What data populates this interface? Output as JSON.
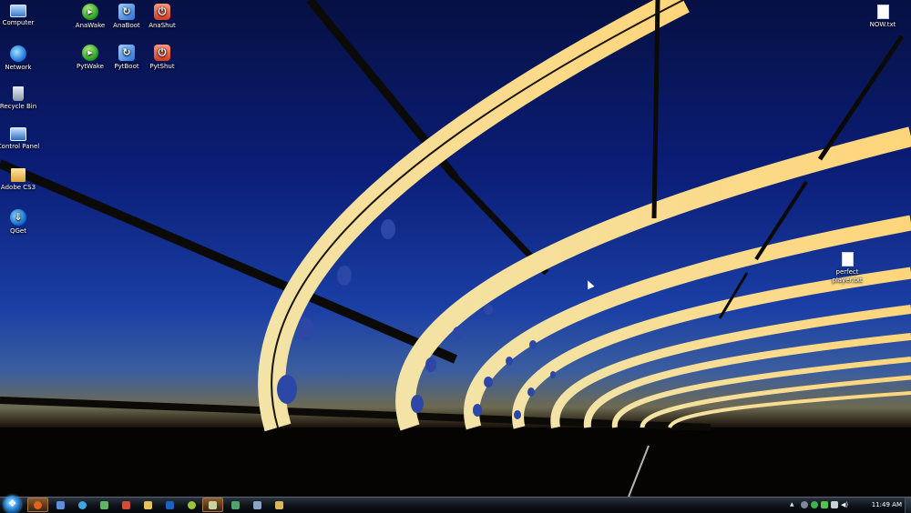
{
  "desktop": {
    "left_icons": [
      {
        "label": "Computer",
        "icon": "computer-icon"
      },
      {
        "label": "Network",
        "icon": "network-icon"
      },
      {
        "label": "Recycle Bin",
        "icon": "recycle-bin-icon"
      },
      {
        "label": "Control Panel",
        "icon": "control-panel-icon"
      },
      {
        "label": "Adobe CS3",
        "icon": "folder-icon"
      },
      {
        "label": "QGet",
        "icon": "qget-icon"
      }
    ],
    "shortcut_icons": [
      {
        "label": "AnaWake",
        "icon": "wake-icon"
      },
      {
        "label": "AnaBoot",
        "icon": "boot-icon"
      },
      {
        "label": "AnaShut",
        "icon": "shut-icon"
      },
      {
        "label": "PytWake",
        "icon": "wake-icon"
      },
      {
        "label": "PytBoot",
        "icon": "boot-icon"
      },
      {
        "label": "PytShut",
        "icon": "shut-icon"
      }
    ],
    "right_icons": [
      {
        "label": "NOW.txt",
        "icon": "text-file-icon"
      },
      {
        "label": "perfect player.txt",
        "icon": "text-file-icon"
      }
    ]
  },
  "taskbar": {
    "start_button": "windows-orb-icon",
    "pinned": [
      {
        "icon": "firefox-icon",
        "color": "#e0621c"
      },
      {
        "icon": "explorer-window-icon",
        "color": "#5b8fd8"
      },
      {
        "icon": "skype-icon",
        "color": "#3fa7e0"
      },
      {
        "icon": "app-icon",
        "color": "#62b36a"
      },
      {
        "icon": "app-icon",
        "color": "#d14b3a"
      },
      {
        "icon": "app-icon",
        "color": "#e7c25a"
      },
      {
        "icon": "photoshop-icon",
        "color": "#1f5fbf"
      },
      {
        "icon": "winamp-icon",
        "color": "#9ac43a"
      },
      {
        "icon": "notepad-icon",
        "color": "#c9d3a0"
      },
      {
        "icon": "app-icon",
        "color": "#4fa36b"
      },
      {
        "icon": "app-icon",
        "color": "#8aa3c4"
      },
      {
        "icon": "folder-icon",
        "color": "#d8b75a"
      }
    ],
    "tray_icons": [
      "up-arrow-icon",
      "network-icon",
      "volume-icon",
      "app-icon",
      "app-icon",
      "signal-icon"
    ],
    "clock": "11:49 AM"
  }
}
